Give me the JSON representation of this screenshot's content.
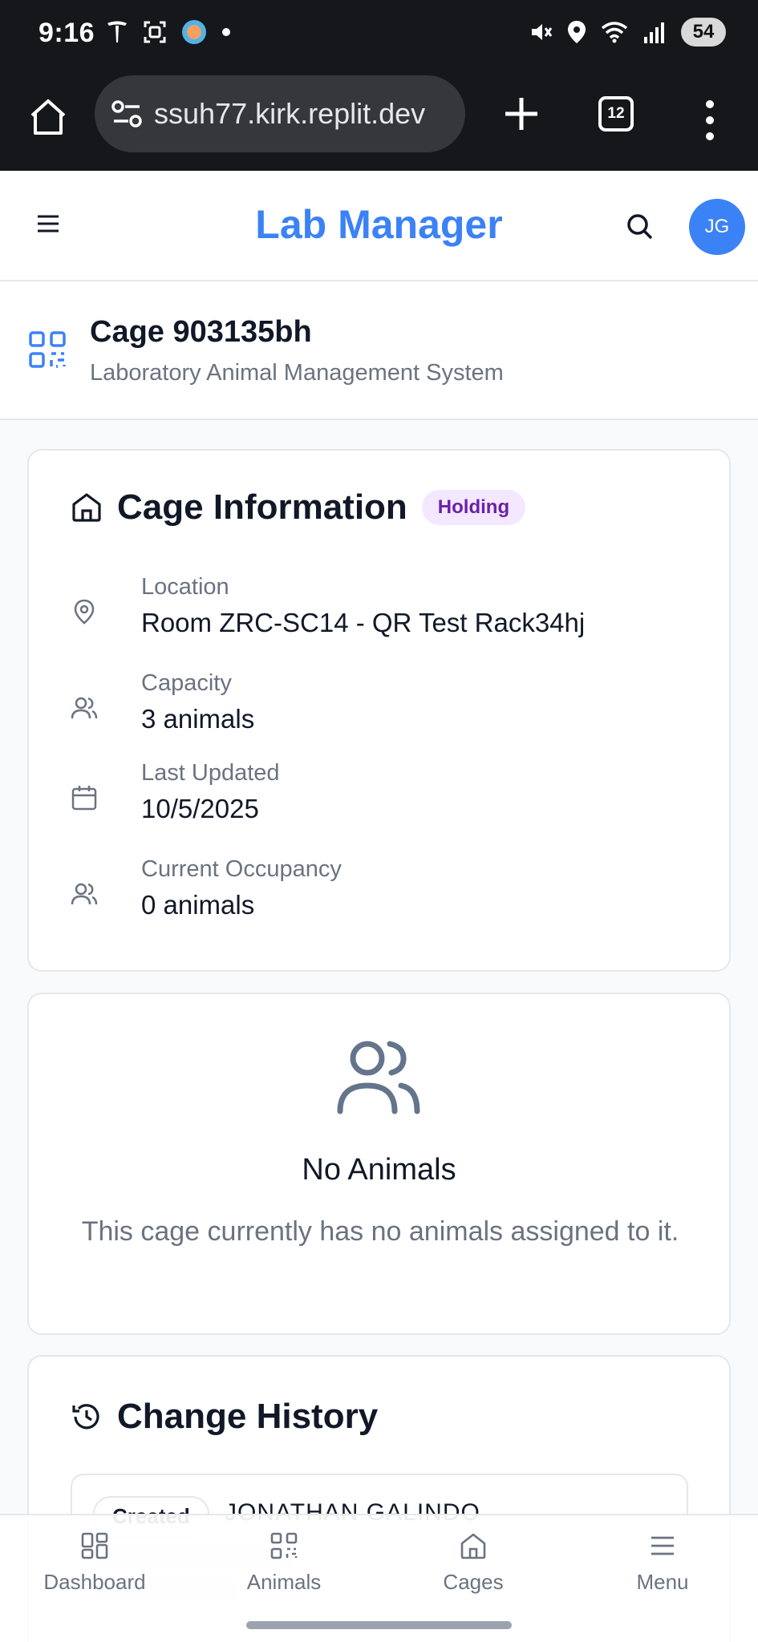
{
  "status_bar": {
    "time": "9:16",
    "battery": "54"
  },
  "browser": {
    "url": "ssuh77.kirk.replit.dev",
    "tab_count": "12"
  },
  "header": {
    "title": "Lab Manager",
    "avatar_initials": "JG",
    "accent_color": "#3b82f6"
  },
  "page": {
    "title": "Cage 903135bh",
    "subtitle": "Laboratory Animal Management System"
  },
  "cage_info": {
    "heading": "Cage Information",
    "status_badge": "Holding",
    "rows": [
      {
        "label": "Location",
        "value": "Room ZRC-SC14 - QR Test Rack34hj",
        "icon": "map-pin-icon"
      },
      {
        "label": "Capacity",
        "value": "3 animals",
        "icon": "users-icon"
      },
      {
        "label": "Last Updated",
        "value": "10/5/2025",
        "icon": "calendar-icon"
      },
      {
        "label": "Current Occupancy",
        "value": "0 animals",
        "icon": "users-icon"
      }
    ]
  },
  "empty_state": {
    "title": "No Animals",
    "message": "This cage currently has no animals assigned to it."
  },
  "history": {
    "heading": "Change History",
    "entries": [
      {
        "action": "Created",
        "user": "JONATHAN GALINDO"
      }
    ]
  },
  "bottom_nav": {
    "items": [
      {
        "label": "Dashboard",
        "icon": "grid-icon"
      },
      {
        "label": "Animals",
        "icon": "qr-code-icon"
      },
      {
        "label": "Cages",
        "icon": "home-icon"
      },
      {
        "label": "Menu",
        "icon": "menu-icon"
      }
    ]
  }
}
